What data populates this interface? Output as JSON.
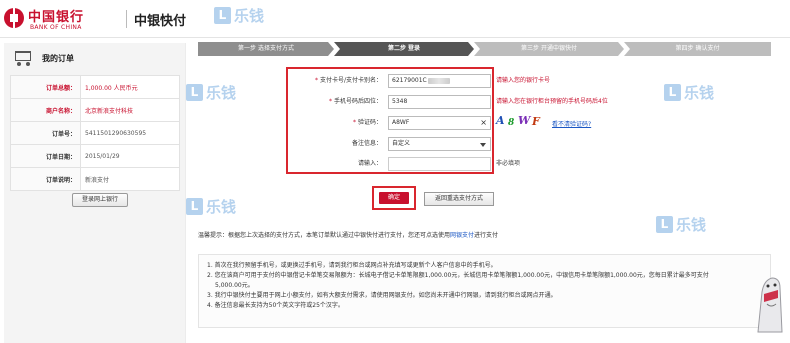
{
  "header": {
    "logo_cn": "中国银行",
    "logo_en": "BANK OF CHINA",
    "subtitle": "中银快付"
  },
  "watermark": {
    "badge": "L",
    "text": "乐钱"
  },
  "sidebar": {
    "title": "我的订单",
    "rows": [
      {
        "label": "订单总额：",
        "value": "1,000.00 人民币元"
      },
      {
        "label": "商户名称：",
        "value": "北京新浪支付科技"
      },
      {
        "label": "订单号：",
        "value": "5411501290630595"
      },
      {
        "label": "订单日期：",
        "value": "2015/01/29"
      },
      {
        "label": "订单说明：",
        "value": "新浪支付"
      }
    ],
    "login_button": "登录网上银行"
  },
  "steps": [
    {
      "label": "第一步 选择支付方式",
      "state": "done"
    },
    {
      "label": "第二步 登录",
      "state": "active"
    },
    {
      "label": "第三步 开通中银快付",
      "state": "pending"
    },
    {
      "label": "第四步 确认支付",
      "state": "pending"
    }
  ],
  "form": {
    "card_label": "支付卡号/支付卡别名：",
    "card_value": "62179001C",
    "card_hint": "请输入您的银行卡号",
    "phone_label": "手机号码后四位：",
    "phone_value": "5348",
    "phone_hint": "请输入您在银行柜台预留的手机号码后4位",
    "captcha_label": "验证码：",
    "captcha_value": "A8WF",
    "captcha_clear": "×",
    "captcha_chars": [
      "A",
      "8",
      "W",
      "F"
    ],
    "captcha_link": "看不清验证码?",
    "note_label": "备注信息：",
    "note_value": "自定义",
    "input_label": "请输入：",
    "input_hint": "非必填项"
  },
  "buttons": {
    "confirm": "确定",
    "back": "返回重选支付方式"
  },
  "tip": {
    "prefix": "温馨提示：根据您上次选择的支付方式，本笔订单默认通过中银快付进行支付，您还可点选使用",
    "link": "网银支付",
    "suffix": "进行支付"
  },
  "notes": [
    "1. 首次在我行预留手机号，或更换过手机号，请到我行柜台或网点补充填写或更新个人客户信息中的手机号。",
    "2. 您在该商户可用于支付的中银借记卡单笔交易限额为：长城电子借记卡单笔限额1,000.00元，长城信用卡单笔限额1,000.00元，中银信用卡单笔限额1,000.00元，您每日累计最多可支付",
    "5,000.00元。",
    "3. 我行中银快付主要用于网上小额支付，如有大额支付需求，请使用网银支付。如您尚未开通中行网银，请到我行柜台或网点开通。",
    "4. 备注信息最长支持为50个英文字符或25个汉字。"
  ],
  "colors": {
    "brand_red": "#c8102e",
    "step_active": "#555555",
    "step_done": "#8e8e8e",
    "step_pending": "#bdbdbd",
    "link_blue": "#1b57c4",
    "watermark_blue": "#2f7fd0",
    "highlight_border": "#d9262e"
  }
}
